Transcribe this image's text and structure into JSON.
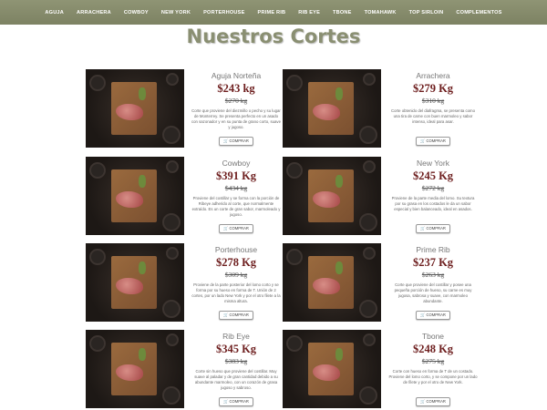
{
  "nav": {
    "items": [
      "AGUJA",
      "ARRACHERA",
      "COWBOY",
      "NEW YORK",
      "PORTERHOUSE",
      "PRIME RIB",
      "RIB EYE",
      "TBONE",
      "TOMAHAWK",
      "TOP SIRLOIN",
      "COMPLEMENTOS"
    ]
  },
  "page": {
    "title": "Nuestros Cortes"
  },
  "products": [
    {
      "name": "Aguja Norteña",
      "price": "$243 kg",
      "old_price": "$270 kg",
      "desc": "Corte que proviene del diezmillo o pecho y su lugar de Monterrey. Se presenta perfecto en un asado con sazonador y en su punta de grano corto, suave y jugoso.",
      "button": "COMPRAR"
    },
    {
      "name": "Arrachera",
      "price": "$279 Kg",
      "old_price": "$310 kg",
      "desc": "Corte obtenido del diafragma, se presenta como una tira de carne con buen marmoleo y sabor intenso, ideal para asar.",
      "button": "COMPRAR"
    },
    {
      "name": "Cowboy",
      "price": "$391 Kg",
      "old_price": "$434 kg",
      "desc": "Proviene del costillar y se forma con la porción de Ribeye adherido al corte, que normalmente extraído. Es un corte de gran sabor, marmoleado y jugoso.",
      "button": "COMPRAR"
    },
    {
      "name": "New York",
      "price": "$245 Kg",
      "old_price": "$272 kg",
      "desc": "Proviene de la parte media del lomo. Su textura por su grasa en los costados le da un sabor especial y bien balanceado, ideal en asados.",
      "button": "COMPRAR"
    },
    {
      "name": "Porterhouse",
      "price": "$278 Kg",
      "old_price": "$309 kg",
      "desc": "Proviene de la parte posterior del lomo corto y se forma por su hueso en forma de T. Unión de 2 cortes, por un lado New York y por el otro filete a la misma altura.",
      "button": "COMPRAR"
    },
    {
      "name": "Prime Rib",
      "price": "$237 Kg",
      "old_price": "$263 kg",
      "desc": "Corte que proviene del costillar y posee una pequeña porción de hueso, su carne es muy jugosa, sabrosa y suave, con marmoleo abundante.",
      "button": "COMPRAR"
    },
    {
      "name": "Rib Eye",
      "price": "$345 Kg",
      "old_price": "$383 kg",
      "desc": "Corte sin hueso que proviene del costillar. Muy suave al paladar y de gran cantidad debido a su abundante marmoleo, con un corazón de grasa jugoso y sabroso.",
      "button": "COMPRAR"
    },
    {
      "name": "Tbone",
      "price": "$248 Kg",
      "old_price": "$275 kg",
      "desc": "Corte con hueso en forma de T de un costado. Proviene del lomo corto, y se compone por un lado de filete y por el otro de New York.",
      "button": "COMPRAR"
    }
  ]
}
